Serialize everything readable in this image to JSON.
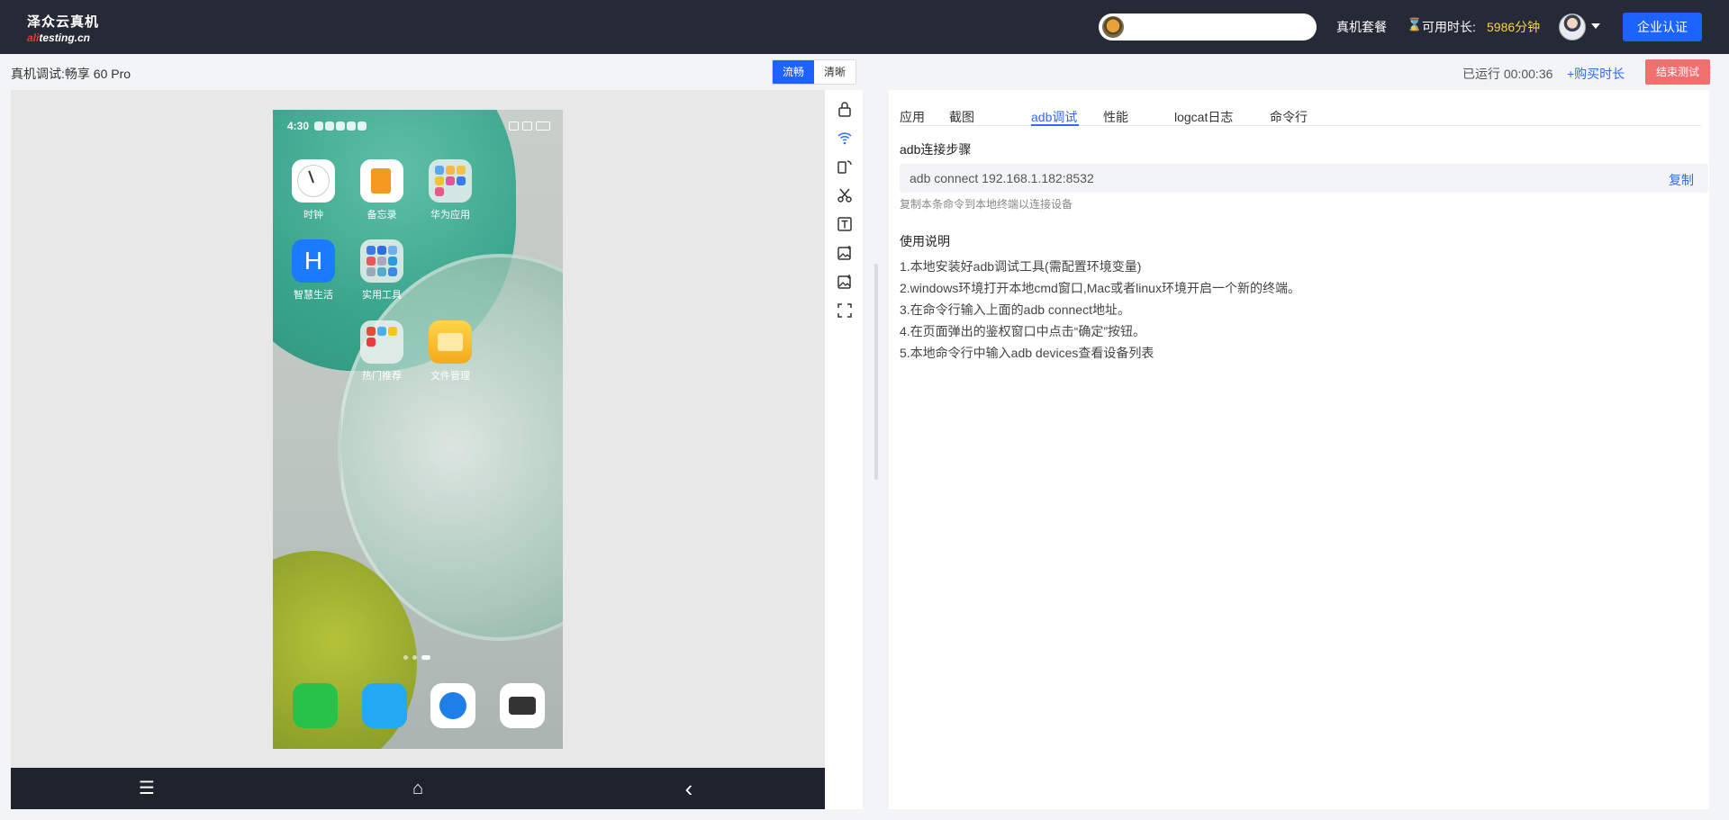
{
  "header": {
    "logo_line1": "泽众云真机",
    "logo_prefix": "ali",
    "logo_suffix": "testing.cn",
    "plan_link": "真机套餐",
    "avail_label": "可用时长:",
    "avail_value": "5986分钟",
    "enterprise_button": "企业认证"
  },
  "subbar": {
    "device_title": "真机调试:畅享 60 Pro",
    "quality_options": [
      "流畅",
      "清晰"
    ],
    "running": "已运行 00:00:36",
    "buy_more": "+购买时长",
    "end_test": "结束测试"
  },
  "phone": {
    "time": "4:30",
    "apps": [
      {
        "name": "时钟"
      },
      {
        "name": "备忘录"
      },
      {
        "name": "华为应用"
      },
      {
        "name": "智慧生活"
      },
      {
        "name": "实用工具"
      },
      {
        "name": "热门推荐"
      },
      {
        "name": "文件管理"
      }
    ],
    "dock": [
      "phone-icon",
      "messages-icon",
      "browser-icon",
      "camera-icon"
    ]
  },
  "navbar": {
    "menu": "☰",
    "home": "⌂",
    "back": "‹"
  },
  "tools": [
    "lock-icon",
    "wifi-icon",
    "rotate-icon",
    "cut-icon",
    "text-icon",
    "image-add-icon",
    "image-download-icon",
    "fullscreen-icon"
  ],
  "panel": {
    "tabs": [
      "应用",
      "截图",
      "adb调试",
      "性能",
      "logcat日志",
      "命令行"
    ],
    "active_tab": "adb调试",
    "steps_title": "adb连接步骤",
    "command": "adb connect 192.168.1.182:8532",
    "copy_label": "复制",
    "hint": "复制本条命令到本地终端以连接设备",
    "usage_title": "使用说明",
    "usage_steps": [
      "1.本地安装好adb调试工具(需配置环境变量)",
      "2.windows环境打开本地cmd窗口,Mac或者linux环境开启一个新的终端。",
      "3.在命令行输入上面的adb connect地址。",
      "4.在页面弹出的鉴权窗口中点击“确定”按钮。",
      "5.本地命令行中输入adb devices查看设备列表"
    ]
  },
  "colors": {
    "accent": "#1c63ff",
    "topbar": "#262a36",
    "highlight": "#f7d24a",
    "danger": "#f07070"
  }
}
